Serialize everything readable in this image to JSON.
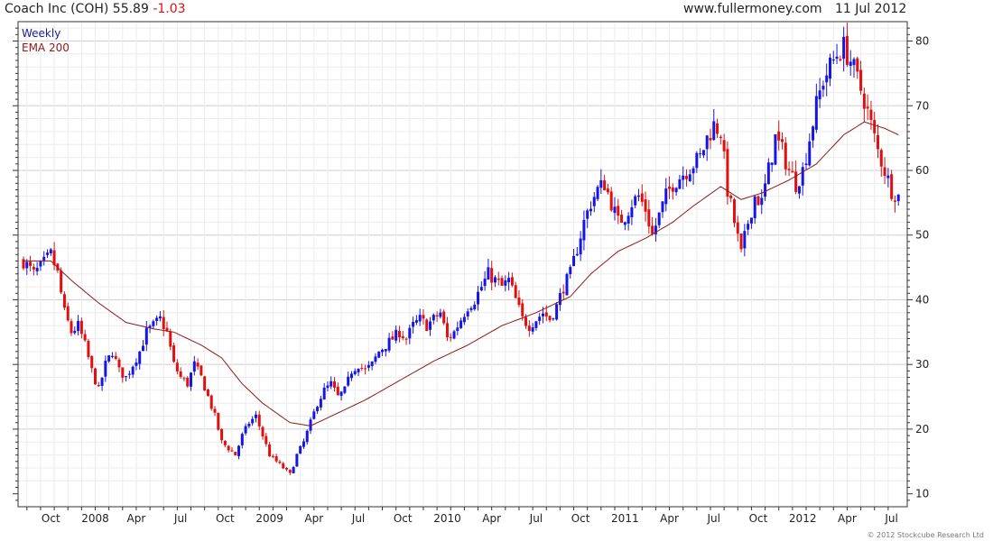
{
  "header": {
    "title": "Coach Inc (COH) 55.89",
    "change": "-1.03",
    "site": "www.fullermoney.com",
    "date": "11 Jul 2012"
  },
  "copyright": "© 2012 Stockcube Research Ltd",
  "colors": {
    "up": "#1515e6",
    "down": "#e01010",
    "ema": "#8b1a1a",
    "grid": "#d7d7d7"
  },
  "chart_data": {
    "type": "candlestick",
    "legend": [
      {
        "label": "Weekly",
        "color": "#1a1a9c"
      },
      {
        "label": "EMA 200",
        "color": "#8b1a1a"
      }
    ],
    "ylim": [
      8,
      83
    ],
    "y_ticks": [
      10,
      20,
      30,
      40,
      50,
      60,
      70,
      80
    ],
    "x_labels": [
      {
        "label": "Oct",
        "week": 8
      },
      {
        "label": "2008",
        "week": 21
      },
      {
        "label": "Apr",
        "week": 33
      },
      {
        "label": "Jul",
        "week": 46
      },
      {
        "label": "Oct",
        "week": 59
      },
      {
        "label": "2009",
        "week": 72
      },
      {
        "label": "Apr",
        "week": 85
      },
      {
        "label": "Jul",
        "week": 98
      },
      {
        "label": "Oct",
        "week": 111
      },
      {
        "label": "2010",
        "week": 124
      },
      {
        "label": "Apr",
        "week": 137
      },
      {
        "label": "Jul",
        "week": 150
      },
      {
        "label": "Oct",
        "week": 163
      },
      {
        "label": "2011",
        "week": 176
      },
      {
        "label": "Apr",
        "week": 189
      },
      {
        "label": "Jul",
        "week": 202
      },
      {
        "label": "Oct",
        "week": 215
      },
      {
        "label": "2012",
        "week": 228
      },
      {
        "label": "Apr",
        "week": 241
      },
      {
        "label": "Jul",
        "week": 254
      }
    ],
    "close_anchors": [
      [
        0,
        46
      ],
      [
        3,
        44
      ],
      [
        5,
        45
      ],
      [
        8,
        47
      ],
      [
        10,
        44
      ],
      [
        12,
        38
      ],
      [
        14,
        35
      ],
      [
        16,
        36
      ],
      [
        18,
        33
      ],
      [
        20,
        29
      ],
      [
        22,
        26
      ],
      [
        24,
        30
      ],
      [
        26,
        32
      ],
      [
        28,
        29
      ],
      [
        30,
        28
      ],
      [
        32,
        30
      ],
      [
        34,
        32
      ],
      [
        36,
        35
      ],
      [
        38,
        36
      ],
      [
        40,
        37
      ],
      [
        42,
        35
      ],
      [
        44,
        30
      ],
      [
        46,
        28
      ],
      [
        48,
        27
      ],
      [
        50,
        30
      ],
      [
        52,
        28
      ],
      [
        54,
        25
      ],
      [
        56,
        22
      ],
      [
        58,
        18
      ],
      [
        60,
        17
      ],
      [
        62,
        16
      ],
      [
        64,
        19
      ],
      [
        66,
        21
      ],
      [
        68,
        22
      ],
      [
        70,
        19
      ],
      [
        72,
        16
      ],
      [
        74,
        15
      ],
      [
        76,
        14
      ],
      [
        78,
        13
      ],
      [
        80,
        16
      ],
      [
        82,
        18
      ],
      [
        84,
        21
      ],
      [
        86,
        24
      ],
      [
        88,
        26
      ],
      [
        90,
        27
      ],
      [
        92,
        25
      ],
      [
        94,
        26
      ],
      [
        96,
        29
      ],
      [
        98,
        30
      ],
      [
        100,
        29
      ],
      [
        102,
        30
      ],
      [
        104,
        32
      ],
      [
        106,
        33
      ],
      [
        108,
        34
      ],
      [
        110,
        35
      ],
      [
        112,
        34
      ],
      [
        114,
        36
      ],
      [
        116,
        37
      ],
      [
        118,
        36
      ],
      [
        120,
        37
      ],
      [
        122,
        38
      ],
      [
        124,
        34
      ],
      [
        126,
        35
      ],
      [
        128,
        37
      ],
      [
        130,
        39
      ],
      [
        132,
        40
      ],
      [
        134,
        42
      ],
      [
        136,
        44
      ],
      [
        138,
        43
      ],
      [
        140,
        42
      ],
      [
        142,
        43
      ],
      [
        144,
        40
      ],
      [
        146,
        37
      ],
      [
        148,
        36
      ],
      [
        150,
        37
      ],
      [
        152,
        38
      ],
      [
        154,
        37
      ],
      [
        156,
        39
      ],
      [
        158,
        42
      ],
      [
        160,
        44
      ],
      [
        162,
        48
      ],
      [
        164,
        52
      ],
      [
        166,
        55
      ],
      [
        168,
        57
      ],
      [
        170,
        58
      ],
      [
        172,
        55
      ],
      [
        174,
        52
      ],
      [
        176,
        53
      ],
      [
        178,
        55
      ],
      [
        180,
        56
      ],
      [
        182,
        54
      ],
      [
        184,
        50
      ],
      [
        186,
        53
      ],
      [
        188,
        56
      ],
      [
        190,
        58
      ],
      [
        192,
        59
      ],
      [
        194,
        60
      ],
      [
        196,
        61
      ],
      [
        198,
        62
      ],
      [
        200,
        65
      ],
      [
        202,
        67
      ],
      [
        204,
        66
      ],
      [
        206,
        57
      ],
      [
        208,
        52
      ],
      [
        210,
        47
      ],
      [
        212,
        52
      ],
      [
        214,
        56
      ],
      [
        216,
        55
      ],
      [
        218,
        60
      ],
      [
        220,
        65
      ],
      [
        222,
        63
      ],
      [
        224,
        60
      ],
      [
        226,
        58
      ],
      [
        228,
        60
      ],
      [
        230,
        65
      ],
      [
        232,
        70
      ],
      [
        234,
        74
      ],
      [
        236,
        76
      ],
      [
        238,
        78
      ],
      [
        240,
        79
      ],
      [
        242,
        77
      ],
      [
        244,
        74
      ],
      [
        246,
        71
      ],
      [
        248,
        67
      ],
      [
        250,
        63
      ],
      [
        252,
        60
      ],
      [
        254,
        57
      ],
      [
        256,
        56
      ]
    ],
    "ema_anchors": [
      [
        0,
        46
      ],
      [
        8,
        46
      ],
      [
        14,
        43
      ],
      [
        22,
        39.5
      ],
      [
        30,
        36.5
      ],
      [
        38,
        35.5
      ],
      [
        44,
        35
      ],
      [
        52,
        33
      ],
      [
        58,
        31
      ],
      [
        64,
        27
      ],
      [
        70,
        24
      ],
      [
        78,
        21
      ],
      [
        84,
        20.5
      ],
      [
        90,
        22
      ],
      [
        100,
        24.5
      ],
      [
        110,
        27.5
      ],
      [
        120,
        30.5
      ],
      [
        130,
        33
      ],
      [
        140,
        36
      ],
      [
        150,
        38
      ],
      [
        160,
        40.5
      ],
      [
        166,
        44
      ],
      [
        174,
        47.5
      ],
      [
        182,
        49.5
      ],
      [
        190,
        52
      ],
      [
        196,
        54.5
      ],
      [
        204,
        57.5
      ],
      [
        210,
        55.5
      ],
      [
        216,
        56.5
      ],
      [
        224,
        58.5
      ],
      [
        232,
        61
      ],
      [
        240,
        65.5
      ],
      [
        246,
        67.5
      ],
      [
        252,
        66.5
      ],
      [
        256,
        65.5
      ]
    ]
  }
}
